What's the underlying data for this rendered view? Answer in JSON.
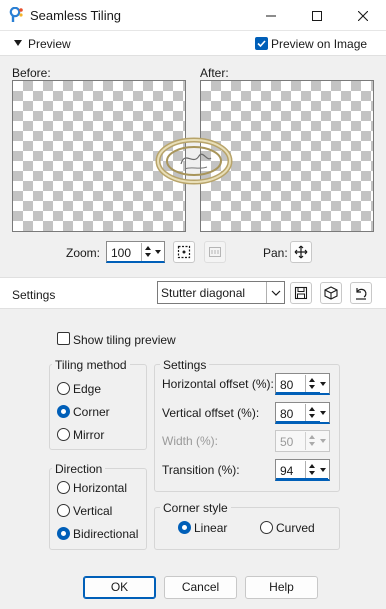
{
  "window": {
    "title": "Seamless Tiling"
  },
  "preview": {
    "section_label": "Preview",
    "preview_on_image_label": "Preview on Image",
    "preview_on_image_checked": true,
    "before_label": "Before:",
    "after_label": "After:",
    "zoom_label": "Zoom:",
    "zoom_value": "100",
    "pan_label": "Pan:",
    "tool_icons": [
      "zoom-fit-icon",
      "zoom-actual-icon",
      "pan-move-icon"
    ]
  },
  "settings": {
    "label": "Settings",
    "preset_value": "Stutter diagonal",
    "preset_icons": [
      "save-preset-icon",
      "manage-presets-icon",
      "reset-default-icon"
    ]
  },
  "options": {
    "show_tiling_preview_label": "Show tiling preview",
    "show_tiling_preview_checked": false,
    "tiling_method": {
      "label": "Tiling method",
      "items": [
        "Edge",
        "Corner",
        "Mirror"
      ],
      "selected": "Corner"
    },
    "direction": {
      "label": "Direction",
      "items": [
        "Horizontal",
        "Vertical",
        "Bidirectional"
      ],
      "selected": "Bidirectional"
    },
    "settings_group": {
      "label": "Settings",
      "horizontal_offset_label": "Horizontal offset (%):",
      "horizontal_offset_value": "80",
      "vertical_offset_label": "Vertical offset (%):",
      "vertical_offset_value": "80",
      "width_label": "Width (%):",
      "width_value": "50",
      "transition_label": "Transition (%):",
      "transition_value": "94"
    },
    "corner_style": {
      "label": "Corner style",
      "items": [
        "Linear",
        "Curved"
      ],
      "selected": "Linear"
    }
  },
  "buttons": {
    "ok_label": "OK",
    "cancel_label": "Cancel",
    "help_label": "Help"
  },
  "colors": {
    "accent": "#005fb8",
    "checker_gray": "#c3c3c3",
    "background": "#f0f0f0"
  }
}
